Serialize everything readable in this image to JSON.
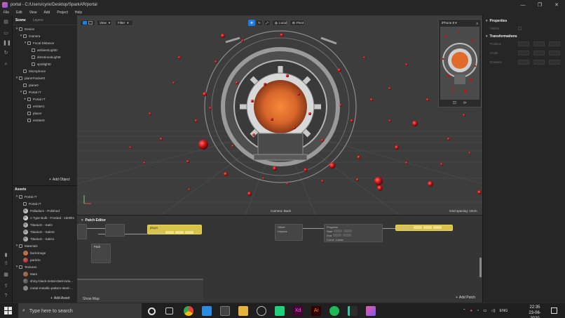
{
  "window": {
    "title": "portal - C:/Users/cyrix/Desktop/SparkAR/portal",
    "minimize": "—",
    "maximize": "❐",
    "close": "✕"
  },
  "menu": [
    "File",
    "Edit",
    "View",
    "Add",
    "Project",
    "Help"
  ],
  "scene_panel": {
    "tabs": [
      "Scene",
      "Layers"
    ],
    "items": [
      {
        "label": "Device",
        "depth": 0,
        "caret": "▾"
      },
      {
        "label": "Camera",
        "depth": 1,
        "caret": "▾"
      },
      {
        "label": "Focal Distance",
        "depth": 2,
        "caret": "▾"
      },
      {
        "label": "ambientLight0",
        "depth": 3,
        "caret": ""
      },
      {
        "label": "directionalLight0",
        "depth": 3,
        "caret": ""
      },
      {
        "label": "spotlight0",
        "depth": 3,
        "caret": ""
      },
      {
        "label": "Microphone",
        "depth": 1,
        "caret": ""
      },
      {
        "label": "planeTracker0",
        "depth": 0,
        "caret": "▾"
      },
      {
        "label": "plane0",
        "depth": 1,
        "caret": ""
      },
      {
        "label": "Portal rT",
        "depth": 1,
        "caret": "▾"
      },
      {
        "label": "Portal rT",
        "depth": 2,
        "caret": "▸"
      },
      {
        "label": "emitter1",
        "depth": 2,
        "caret": ""
      },
      {
        "label": "placer",
        "depth": 2,
        "caret": ""
      },
      {
        "label": "emitter0",
        "depth": 2,
        "caret": ""
      }
    ],
    "add_label": "Add Object"
  },
  "assets_panel": {
    "title": "Assets",
    "items": [
      {
        "label": "Portal rT",
        "depth": 0,
        "caret": "▾",
        "kind": "folder",
        "color": ""
      },
      {
        "label": "Portal rT",
        "depth": 1,
        "caret": "",
        "kind": "mesh",
        "color": ""
      },
      {
        "label": "Palladium - Polished",
        "depth": 1,
        "caret": "",
        "kind": "material",
        "color": "#c9c9c9"
      },
      {
        "label": "A Type Bulb - Frosted - 1500lm",
        "depth": 1,
        "caret": "",
        "kind": "material",
        "color": "#e0e0e0"
      },
      {
        "label": "Titanium - Satin",
        "depth": 1,
        "caret": "",
        "kind": "material",
        "color": "#b8b8b8"
      },
      {
        "label": "Titanium - Satin0",
        "depth": 1,
        "caret": "",
        "kind": "material",
        "color": "#b8b8b8"
      },
      {
        "label": "Titanium - Satin1",
        "depth": 1,
        "caret": "",
        "kind": "material",
        "color": "#b8b8b8"
      },
      {
        "label": "Materials",
        "depth": 0,
        "caret": "▾",
        "kind": "folder",
        "color": ""
      },
      {
        "label": "backimage",
        "depth": 1,
        "caret": "",
        "kind": "material",
        "color": "#e46a2c"
      },
      {
        "label": "particle",
        "depth": 1,
        "caret": "",
        "kind": "material",
        "color": "#d62a2a"
      },
      {
        "label": "Textures",
        "depth": 0,
        "caret": "▾",
        "kind": "folder",
        "color": ""
      },
      {
        "label": "Mars",
        "depth": 1,
        "caret": "",
        "kind": "texture",
        "color": "#b65a2e"
      },
      {
        "label": "shiny-black-metal-steel-indu...",
        "depth": 1,
        "caret": "",
        "kind": "texture",
        "color": "#555"
      },
      {
        "label": "metal-metallic-pattern-steel-...",
        "depth": 1,
        "caret": "",
        "kind": "texture",
        "color": "#888"
      }
    ],
    "add_label": "Add Asset"
  },
  "viewport": {
    "view_label": "View",
    "filter_label": "Filter",
    "local_label": "Local",
    "pivot_label": "Pivot",
    "camera_label": "Camera: Back",
    "grid_label": "Grid spacing: 10cm"
  },
  "simulator": {
    "device": "iPhone 8"
  },
  "properties": {
    "title": "Properties",
    "visible_label": "Visible",
    "transformations_title": "Transformations",
    "rows": [
      "Position",
      "Scale",
      "Rotation"
    ]
  },
  "patch_editor": {
    "title": "Patch Editor",
    "add_label": "Add Patch",
    "show_map": "Show Map",
    "nodes": {
      "player": "player",
      "player_sub": "3D Position",
      "pack": "Pack",
      "unpack": "Unpack",
      "progress": "Progress",
      "start": "Start",
      "end": "End",
      "curve": "Curve",
      "curve_val": "Linear",
      "offset": "Offset",
      "pos": "3D Position",
      "lowpass": "Low Pass"
    }
  },
  "taskbar": {
    "search_placeholder": "Type here to search",
    "lang": "ENG",
    "time": "22:35",
    "date": "23-06-2020"
  },
  "colors": {
    "accent": "#1b7de6",
    "patch_yellow": "#d8c34a",
    "particle": "#c41414",
    "portal_orange": "#e06a2a"
  }
}
